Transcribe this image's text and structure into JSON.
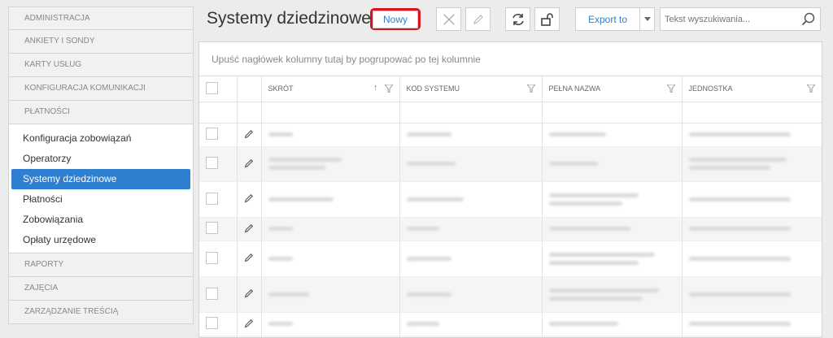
{
  "sidebar": {
    "sections_top": [
      "ADMINISTRACJA",
      "ANKIETY I SONDY",
      "KARTY USŁUG",
      "KONFIGURACJA KOMUNIKACJI",
      "PŁATNOŚCI"
    ],
    "items": [
      "Konfiguracja zobowiązań",
      "Operatorzy",
      "Systemy dziedzinowe",
      "Płatności",
      "Zobowiązania",
      "Opłaty urzędowe"
    ],
    "active_item": "Systemy dziedzinowe",
    "sections_bottom": [
      "RAPORTY",
      "ZAJĘCIA",
      "ZARZĄDZANIE TREŚCIĄ"
    ]
  },
  "header": {
    "title": "Systemy dziedzinowe",
    "new_label": "Nowy",
    "export_label": "Export to",
    "search_placeholder": "Tekst wyszukiwania..."
  },
  "grid": {
    "group_hint": "Upuść nagłówek kolumny tutaj by pogrupować po tej kolumnie",
    "columns": [
      "SKRÓT",
      "KOD SYSTEMU",
      "PEŁNA NAZWA",
      "JEDNOSTKA"
    ],
    "sort_column": "SKRÓT",
    "row_count_visible": 8
  },
  "colors": {
    "accent": "#2f7fd0",
    "highlight": "#d8121e"
  }
}
